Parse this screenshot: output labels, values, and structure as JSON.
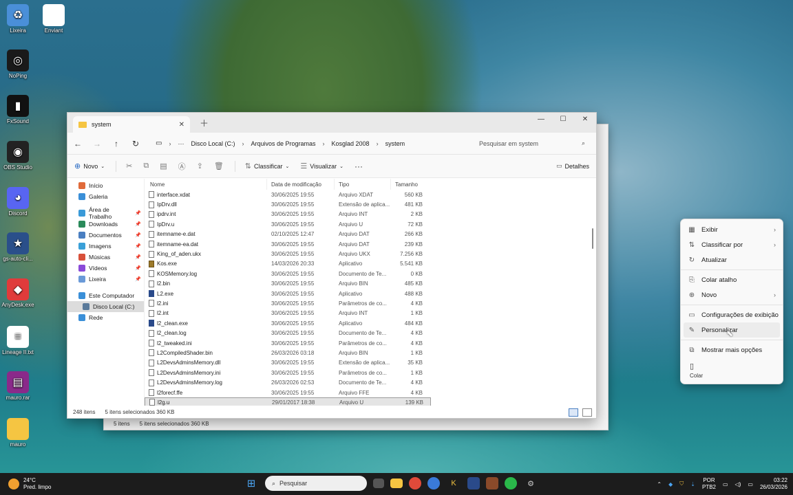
{
  "desktop_icons": [
    {
      "label": "Lixeira",
      "icon": "recycle-bin-icon",
      "color": "#4a8fd8",
      "glyph": "♻"
    },
    {
      "label": "Enviant",
      "icon": "document-icon",
      "color": "#ffffff",
      "glyph": ""
    },
    {
      "label": "NoPing",
      "icon": "noping-icon",
      "color": "#1a1a1a",
      "glyph": "◎"
    },
    {
      "label": "FxSound",
      "icon": "fxsound-icon",
      "color": "#111111",
      "glyph": "▮"
    },
    {
      "label": "OBS Studio",
      "icon": "obs-icon",
      "color": "#222222",
      "glyph": "◉"
    },
    {
      "label": "Discord",
      "icon": "discord-icon",
      "color": "#5865f2",
      "glyph": "◕"
    },
    {
      "label": "gs-auto-cli...",
      "icon": "star-icon",
      "color": "#2a4f8a",
      "glyph": "★"
    },
    {
      "label": "AnyDesk.exe",
      "icon": "anydesk-icon",
      "color": "#e03b3b",
      "glyph": "◆"
    },
    {
      "label": "Lineage II.txt",
      "icon": "text-file-icon",
      "color": "#ffffff",
      "glyph": "≡"
    },
    {
      "label": "mauro.rar",
      "icon": "rar-icon",
      "color": "#8a2a8a",
      "glyph": "▤"
    },
    {
      "label": "mauro",
      "icon": "folder-icon",
      "color": "#f5c542",
      "glyph": ""
    }
  ],
  "back_window": {
    "status_items": "5 itens",
    "status_selected": "5 itens selecionados  360 KB"
  },
  "window": {
    "tab_title": "system",
    "breadcrumbs": [
      "Disco Local (C:)",
      "Arquivos de Programas",
      "Kosglad 2008",
      "system"
    ],
    "search_placeholder": "Pesquisar em system",
    "commands": {
      "new": "Novo",
      "sort": "Classificar",
      "view": "Visualizar",
      "details": "Detalhes"
    },
    "sidebar": [
      {
        "label": "Início",
        "icon": "home-icon",
        "color": "#e06a3a",
        "pin": false
      },
      {
        "label": "Galeria",
        "icon": "gallery-icon",
        "color": "#3a8fd8",
        "pin": false
      },
      {
        "label": "Área de Trabalho",
        "icon": "desktop-icon",
        "color": "#3a9ad8",
        "pin": true
      },
      {
        "label": "Downloads",
        "icon": "downloads-icon",
        "color": "#2a8a5a",
        "pin": true
      },
      {
        "label": "Documentos",
        "icon": "documents-icon",
        "color": "#4a7fc1",
        "pin": true
      },
      {
        "label": "Imagens",
        "icon": "images-icon",
        "color": "#3aa0d8",
        "pin": true
      },
      {
        "label": "Músicas",
        "icon": "music-icon",
        "color": "#d8503a",
        "pin": true
      },
      {
        "label": "Vídeos",
        "icon": "videos-icon",
        "color": "#8a4ad8",
        "pin": true
      },
      {
        "label": "Lixeira",
        "icon": "recycle-bin-icon",
        "color": "#6a9ad8",
        "pin": true
      },
      {
        "label": "Este Computador",
        "icon": "computer-icon",
        "color": "#3a8fd8",
        "pin": false
      },
      {
        "label": "Disco Local (C:)",
        "icon": "drive-icon",
        "color": "#5a7a9a",
        "pin": false
      },
      {
        "label": "Rede",
        "icon": "network-icon",
        "color": "#3a8fd8",
        "pin": false
      }
    ],
    "columns": {
      "name": "Nome",
      "date": "Data de modificação",
      "type": "Tipo",
      "size": "Tamanho"
    },
    "files": [
      {
        "name": "interface.xdat",
        "date": "30/06/2025 19:55",
        "type": "Arquivo XDAT",
        "size": "560 KB",
        "kind": "doc"
      },
      {
        "name": "IpDrv.dll",
        "date": "30/06/2025 19:55",
        "type": "Extensão de aplica...",
        "size": "481 KB",
        "kind": "doc"
      },
      {
        "name": "ipdrv.int",
        "date": "30/06/2025 19:55",
        "type": "Arquivo INT",
        "size": "2 KB",
        "kind": "doc"
      },
      {
        "name": "IpDrv.u",
        "date": "30/06/2025 19:55",
        "type": "Arquivo U",
        "size": "72 KB",
        "kind": "doc"
      },
      {
        "name": "itemname-e.dat",
        "date": "02/10/2025 12:47",
        "type": "Arquivo DAT",
        "size": "266 KB",
        "kind": "doc"
      },
      {
        "name": "itemname-ea.dat",
        "date": "30/06/2025 19:55",
        "type": "Arquivo DAT",
        "size": "239 KB",
        "kind": "doc"
      },
      {
        "name": "King_of_aden.ukx",
        "date": "30/06/2025 19:55",
        "type": "Arquivo UKX",
        "size": "7.256 KB",
        "kind": "doc"
      },
      {
        "name": "Kos.exe",
        "date": "14/03/2026 20:33",
        "type": "Aplicativo",
        "size": "5.541 KB",
        "kind": "app"
      },
      {
        "name": "KOSMemory.log",
        "date": "30/06/2025 19:55",
        "type": "Documento de Te...",
        "size": "0 KB",
        "kind": "doc"
      },
      {
        "name": "l2.bin",
        "date": "30/06/2025 19:55",
        "type": "Arquivo BIN",
        "size": "485 KB",
        "kind": "doc"
      },
      {
        "name": "L2.exe",
        "date": "30/06/2025 19:55",
        "type": "Aplicativo",
        "size": "488 KB",
        "kind": "exe"
      },
      {
        "name": "l2.ini",
        "date": "30/06/2025 19:55",
        "type": "Parâmetros de co...",
        "size": "4 KB",
        "kind": "doc"
      },
      {
        "name": "l2.int",
        "date": "30/06/2025 19:55",
        "type": "Arquivo INT",
        "size": "1 KB",
        "kind": "doc"
      },
      {
        "name": "l2_clean.exe",
        "date": "30/06/2025 19:55",
        "type": "Aplicativo",
        "size": "484 KB",
        "kind": "exe"
      },
      {
        "name": "l2_clean.log",
        "date": "30/06/2025 19:55",
        "type": "Documento de Te...",
        "size": "4 KB",
        "kind": "doc"
      },
      {
        "name": "l2_tweaked.ini",
        "date": "30/06/2025 19:55",
        "type": "Parâmetros de co...",
        "size": "4 KB",
        "kind": "doc"
      },
      {
        "name": "L2CompiledShader.bin",
        "date": "26/03/2026 03:18",
        "type": "Arquivo BIN",
        "size": "1 KB",
        "kind": "doc"
      },
      {
        "name": "L2DevsAdminsMemory.dll",
        "date": "30/06/2025 19:55",
        "type": "Extensão de aplica...",
        "size": "35 KB",
        "kind": "doc"
      },
      {
        "name": "L2DevsAdminsMemory.ini",
        "date": "30/06/2025 19:55",
        "type": "Parâmetros de co...",
        "size": "1 KB",
        "kind": "doc"
      },
      {
        "name": "L2DevsAdminsMemory.log",
        "date": "26/03/2026 02:53",
        "type": "Documento de Te...",
        "size": "4 KB",
        "kind": "doc"
      },
      {
        "name": "l2forecf.ffe",
        "date": "30/06/2025 19:55",
        "type": "Arquivo FFE",
        "size": "4 KB",
        "kind": "doc"
      },
      {
        "name": "l2g.u",
        "date": "29/01/2017 18:38",
        "type": "Arquivo U",
        "size": "139 KB",
        "kind": "doc",
        "selected": true
      }
    ],
    "status_count": "248 itens",
    "status_selected": "5 itens selecionados  360 KB"
  },
  "context_menu": [
    {
      "label": "Exibir",
      "icon": "grid-icon",
      "glyph": "▦",
      "submenu": true
    },
    {
      "label": "Classificar por",
      "icon": "sort-icon",
      "glyph": "⇅",
      "submenu": true
    },
    {
      "label": "Atualizar",
      "icon": "refresh-icon",
      "glyph": "↻",
      "submenu": false
    },
    {
      "sep": true
    },
    {
      "label": "Colar atalho",
      "icon": "paste-shortcut-icon",
      "glyph": "⎘",
      "submenu": false
    },
    {
      "label": "Novo",
      "icon": "new-icon",
      "glyph": "⊕",
      "submenu": true
    },
    {
      "sep": true
    },
    {
      "label": "Configurações de exibição",
      "icon": "display-settings-icon",
      "glyph": "▭",
      "submenu": false
    },
    {
      "label": "Personalizar",
      "icon": "brush-icon",
      "glyph": "✎",
      "submenu": false,
      "hover": true
    },
    {
      "sep": true
    },
    {
      "label": "Mostrar mais opções",
      "icon": "more-options-icon",
      "glyph": "⧉",
      "submenu": false
    }
  ],
  "context_paste": "Colar",
  "taskbar": {
    "temperature": "24°C",
    "weather": "Pred. limpo",
    "search_placeholder": "Pesquisar",
    "lang_1": "POR",
    "lang_2": "PTB2",
    "time": "03:22",
    "date": "26/03/2026"
  }
}
